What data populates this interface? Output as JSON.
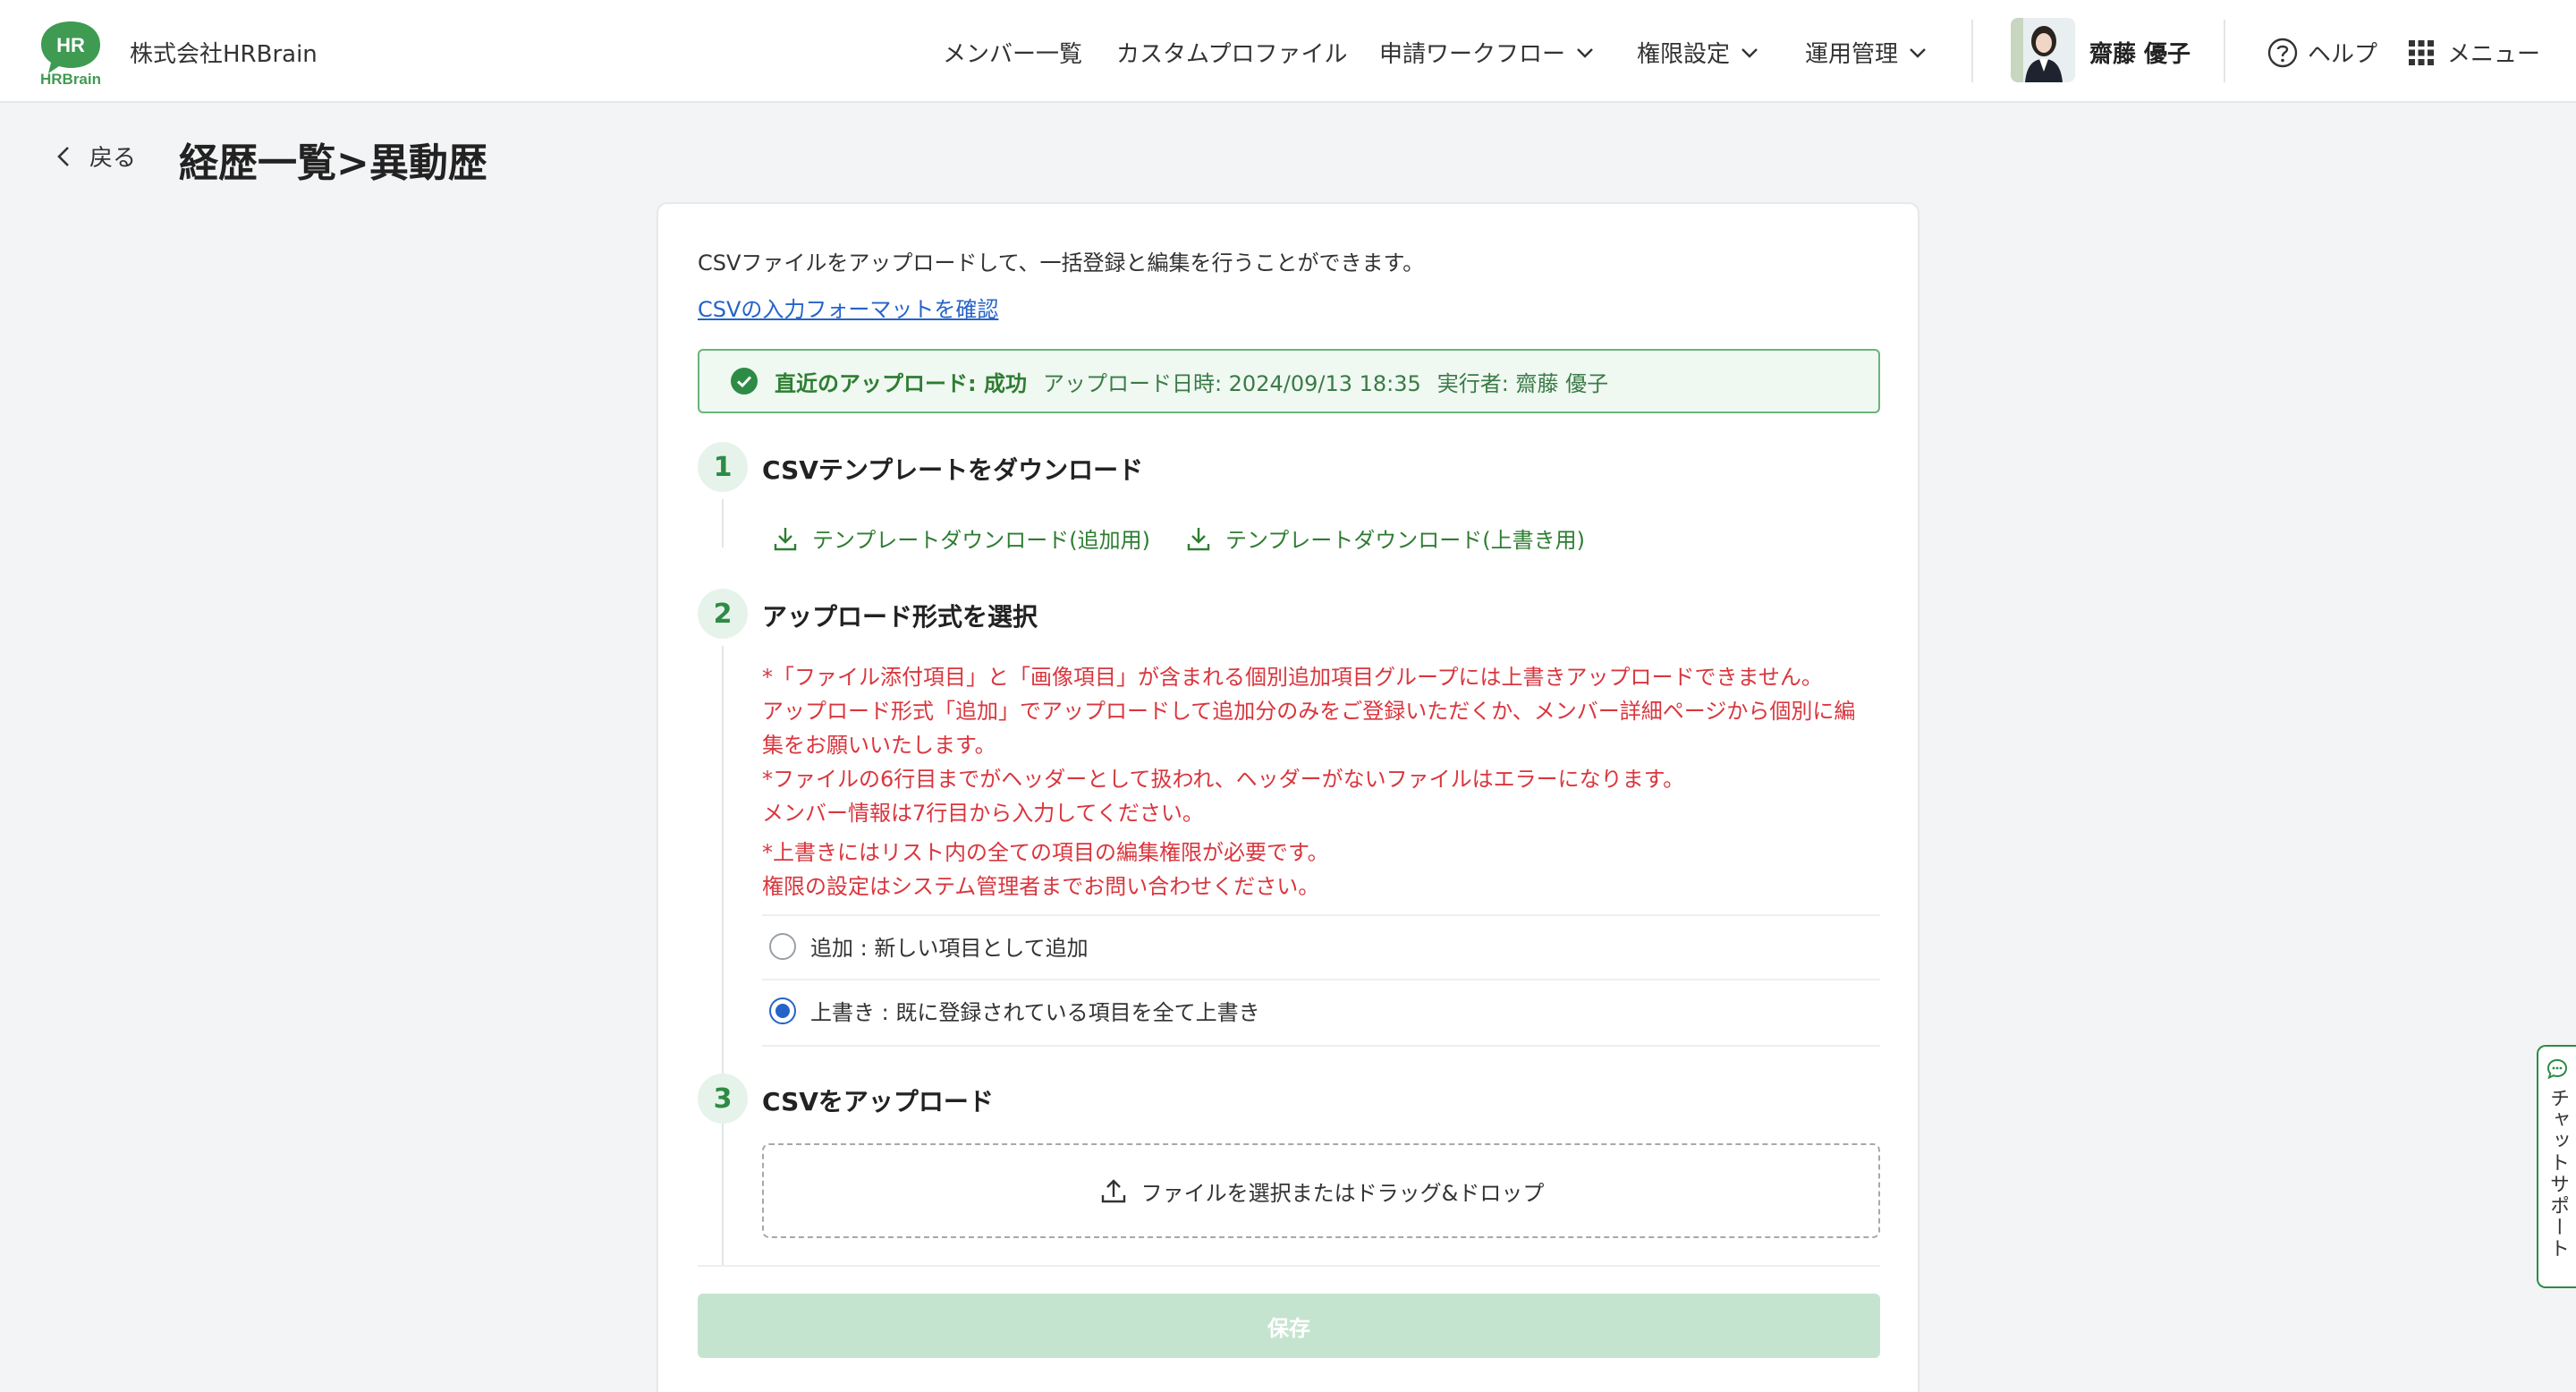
{
  "header": {
    "logo_text": "HR",
    "logo_sub": "HRBrain",
    "company": "株式会社HRBrain",
    "nav": {
      "members": "メンバー一覧",
      "custom_profile": "カスタムプロファイル",
      "workflow": "申請ワークフロー",
      "permissions": "権限設定",
      "operations": "運用管理"
    },
    "user_name": "齋藤 優子",
    "help": "ヘルプ",
    "menu": "メニュー"
  },
  "page": {
    "back": "戻る",
    "title": "経歴一覧>異動歴"
  },
  "card": {
    "intro": "CSVファイルをアップロードして、一括登録と編集を行うことができます。",
    "format_link": "CSVの入力フォーマットを確認",
    "status": {
      "label": "直近のアップロード: 成功",
      "date": "アップロード日時: 2024/09/13 18:35",
      "executor": "実行者: 齋藤 優子"
    },
    "step1": {
      "num": "1",
      "title": "CSVテンプレートをダウンロード",
      "dl_add": "テンプレートダウンロード(追加用)",
      "dl_overwrite": "テンプレートダウンロード(上書き用)"
    },
    "step2": {
      "num": "2",
      "title": "アップロード形式を選択",
      "warn1": "*「ファイル添付項目」と「画像項目」が含まれる個別追加項目グループには上書きアップロードできません。",
      "warn2": "アップロード形式「追加」でアップロードして追加分のみをご登録いただくか、メンバー詳細ページから個別に編",
      "warn3": "集をお願いいたします。",
      "warn4": "*ファイルの6行目までがヘッダーとして扱われ、ヘッダーがないファイルはエラーになります。",
      "warn5": "メンバー情報は7行目から入力してください。",
      "warn6": "*上書きにはリスト内の全ての項目の編集権限が必要です。",
      "warn7": "権限の設定はシステム管理者までお問い合わせください。",
      "option_add": "追加 : 新しい項目として追加",
      "option_overwrite": "上書き : 既に登録されている項目を全て上書き",
      "selected": "overwrite"
    },
    "step3": {
      "num": "3",
      "title": "CSVをアップロード",
      "dropzone": "ファイルを選択またはドラッグ&ドロップ"
    },
    "save": "保存"
  },
  "chat": "チャットサポート",
  "colors": {
    "brand_green": "#2e8b45",
    "link_blue": "#2563c9",
    "warning_red": "#d9363e",
    "save_disabled": "#c5e4cf"
  }
}
